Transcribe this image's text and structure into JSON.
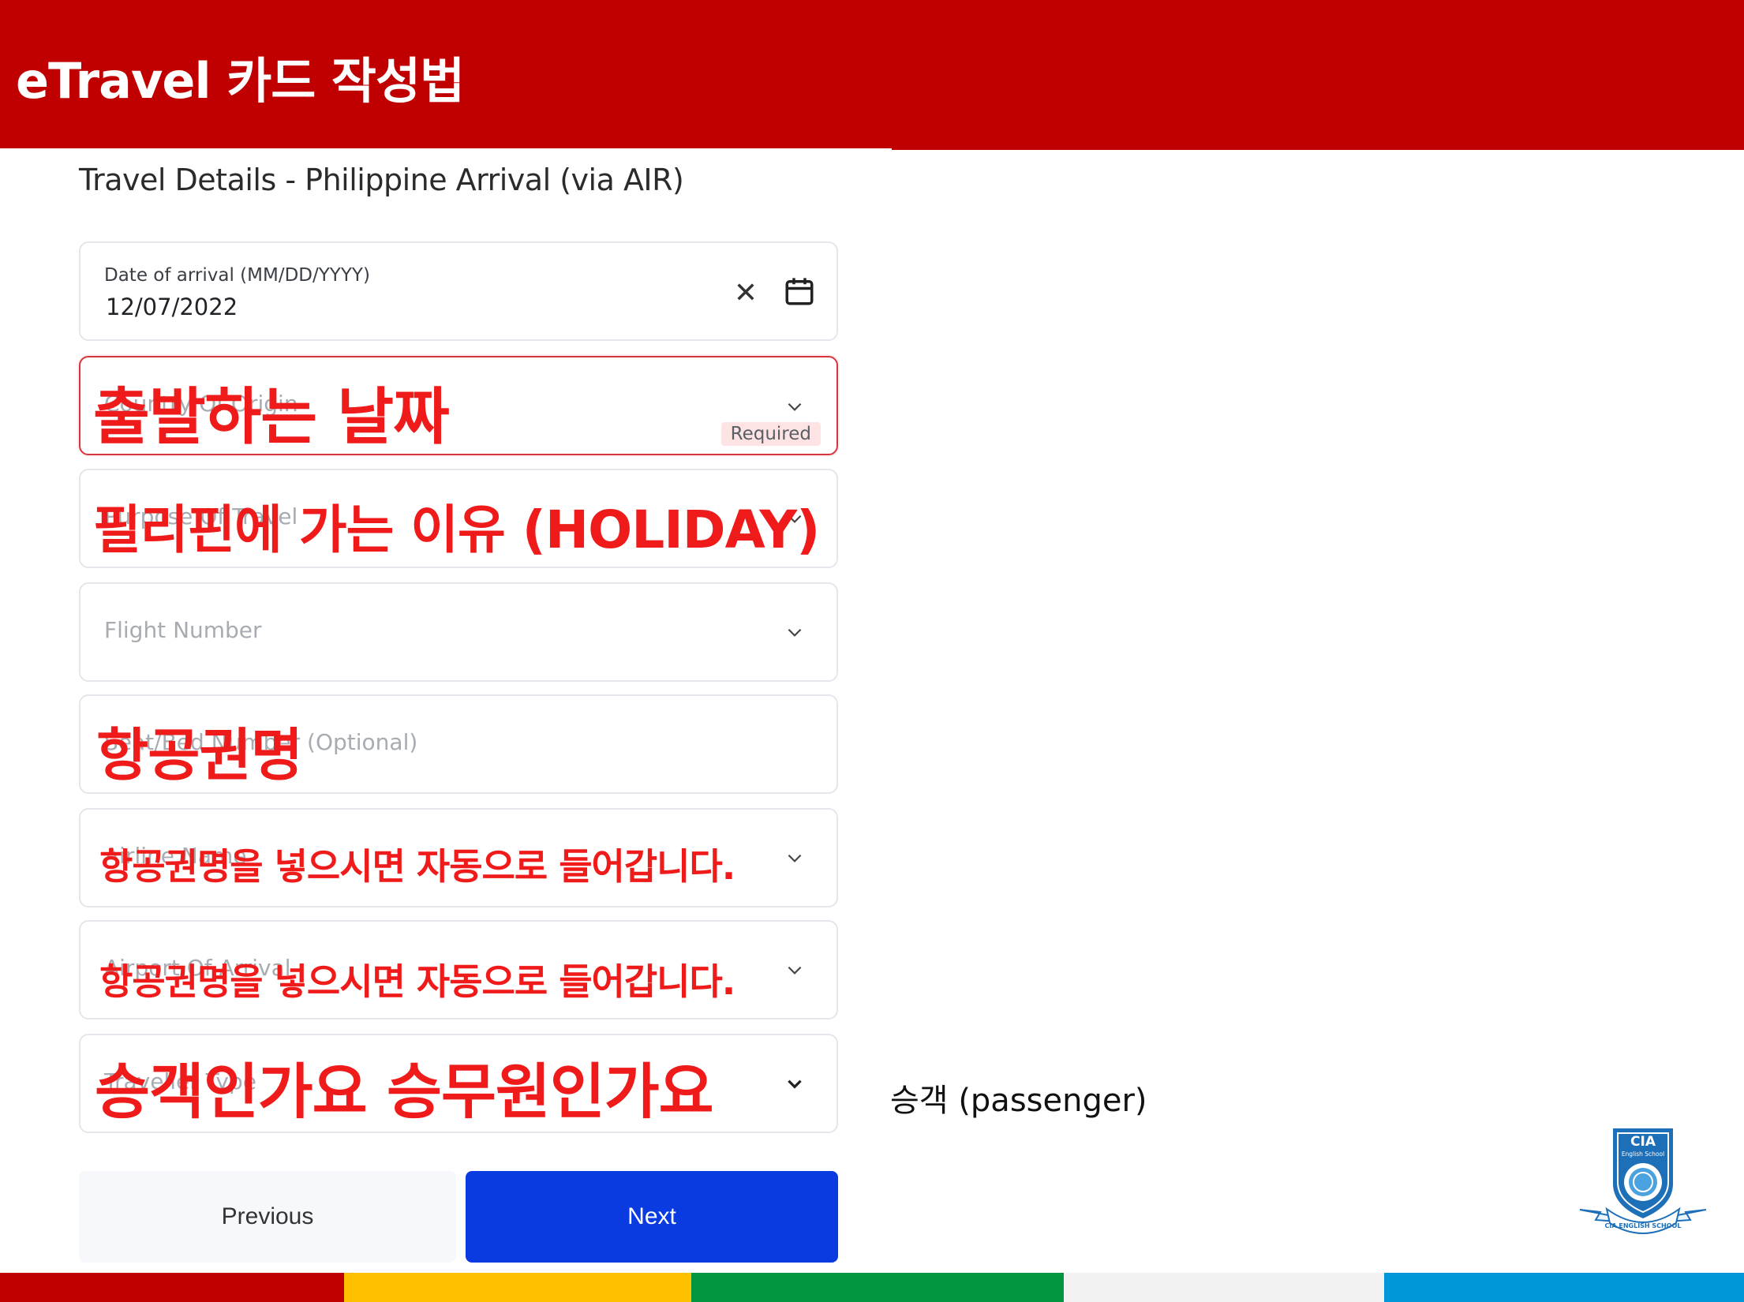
{
  "header": {
    "title": "eTravel 카드 작성법"
  },
  "form": {
    "section_title": "Travel Details - Philippine Arrival (via AIR)",
    "fields": [
      {
        "label": "Date of arrival (MM/DD/YYYY)",
        "value": "12/07/2022"
      },
      {
        "label": "Country Of Origin",
        "required_badge": "Required"
      },
      {
        "label": "Purpose Of Travel"
      },
      {
        "label": "Flight Number"
      },
      {
        "label": "Seat/Bed Number (Optional)"
      },
      {
        "label": "Airline Name"
      },
      {
        "label": "Airport Of Arrival"
      },
      {
        "label": "Traveller Type"
      }
    ],
    "buttons": {
      "previous": "Previous",
      "next": "Next"
    }
  },
  "annotations": {
    "departure_date": "출발하는 날짜",
    "purpose": "필리핀에 가는 이유 (HOLIDAY)",
    "ticket_name": "항공권명",
    "auto_fill_1": "항공권명을 넣으시면 자동으로 들어갑니다.",
    "auto_fill_2": "항공권명을 넣으시면 자동으로 들어갑니다.",
    "traveller_type_question": "승객인가요 승무원인가요",
    "passenger_note": "승객 (passenger)"
  },
  "logo": {
    "top_text": "CIA",
    "sub_text": "English School",
    "ribbon_text": "CIA ENGLISH SCHOOL"
  },
  "colors": {
    "header_red": "#c00000",
    "overlay_red": "#ef1b1b",
    "next_blue": "#0a3be0",
    "stripe": [
      "#c00000",
      "#ffc000",
      "#00963f",
      "#f2f2f2",
      "#0097d8"
    ]
  },
  "icons": [
    "close-icon",
    "calendar-icon",
    "chevron-down-icon"
  ]
}
